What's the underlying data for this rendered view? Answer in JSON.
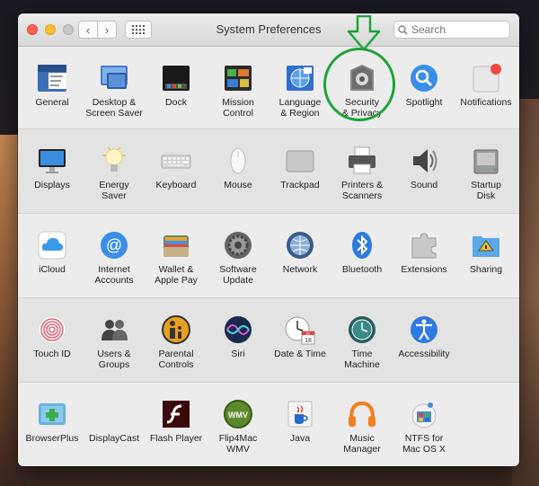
{
  "window": {
    "title": "System Preferences",
    "search_placeholder": "Search"
  },
  "nav": {
    "back": "‹",
    "forward": "›"
  },
  "annotation": {
    "color": "#1fa33a"
  },
  "rows": [
    [
      {
        "id": "general",
        "label": "General",
        "icon": "general-icon"
      },
      {
        "id": "desktop",
        "label": "Desktop &\nScreen Saver",
        "icon": "desktop-screensaver-icon"
      },
      {
        "id": "dock",
        "label": "Dock",
        "icon": "dock-icon"
      },
      {
        "id": "mission",
        "label": "Mission\nControl",
        "icon": "mission-control-icon"
      },
      {
        "id": "language",
        "label": "Language\n& Region",
        "icon": "language-region-icon"
      },
      {
        "id": "security",
        "label": "Security\n& Privacy",
        "icon": "security-privacy-icon"
      },
      {
        "id": "spotlight",
        "label": "Spotlight",
        "icon": "spotlight-icon"
      },
      {
        "id": "notifications",
        "label": "Notifications",
        "icon": "notifications-icon"
      }
    ],
    [
      {
        "id": "displays",
        "label": "Displays",
        "icon": "displays-icon"
      },
      {
        "id": "energy",
        "label": "Energy\nSaver",
        "icon": "energy-saver-icon"
      },
      {
        "id": "keyboard",
        "label": "Keyboard",
        "icon": "keyboard-icon"
      },
      {
        "id": "mouse",
        "label": "Mouse",
        "icon": "mouse-icon"
      },
      {
        "id": "trackpad",
        "label": "Trackpad",
        "icon": "trackpad-icon"
      },
      {
        "id": "printers",
        "label": "Printers &\nScanners",
        "icon": "printer-icon"
      },
      {
        "id": "sound",
        "label": "Sound",
        "icon": "sound-icon"
      },
      {
        "id": "startup",
        "label": "Startup\nDisk",
        "icon": "startup-disk-icon"
      }
    ],
    [
      {
        "id": "icloud",
        "label": "iCloud",
        "icon": "icloud-icon"
      },
      {
        "id": "internet",
        "label": "Internet\nAccounts",
        "icon": "internet-accounts-icon"
      },
      {
        "id": "wallet",
        "label": "Wallet &\nApple Pay",
        "icon": "wallet-icon"
      },
      {
        "id": "software",
        "label": "Software\nUpdate",
        "icon": "software-update-icon"
      },
      {
        "id": "network",
        "label": "Network",
        "icon": "network-icon"
      },
      {
        "id": "bluetooth",
        "label": "Bluetooth",
        "icon": "bluetooth-icon"
      },
      {
        "id": "extensions",
        "label": "Extensions",
        "icon": "extensions-icon"
      },
      {
        "id": "sharing",
        "label": "Sharing",
        "icon": "sharing-icon"
      }
    ],
    [
      {
        "id": "touchid",
        "label": "Touch ID",
        "icon": "touch-id-icon"
      },
      {
        "id": "users",
        "label": "Users &\nGroups",
        "icon": "users-groups-icon"
      },
      {
        "id": "parental",
        "label": "Parental\nControls",
        "icon": "parental-controls-icon"
      },
      {
        "id": "siri",
        "label": "Siri",
        "icon": "siri-icon"
      },
      {
        "id": "datetime",
        "label": "Date & Time",
        "icon": "date-time-icon"
      },
      {
        "id": "timemachine",
        "label": "Time\nMachine",
        "icon": "time-machine-icon"
      },
      {
        "id": "accessibility",
        "label": "Accessibility",
        "icon": "accessibility-icon"
      }
    ],
    [
      {
        "id": "browserplus",
        "label": "BrowserPlus",
        "icon": "browserplus-icon"
      },
      {
        "id": "displaycast",
        "label": "DisplayCast",
        "icon": "displaycast-icon"
      },
      {
        "id": "flash",
        "label": "Flash Player",
        "icon": "flash-player-icon"
      },
      {
        "id": "flip4mac",
        "label": "Flip4Mac\nWMV",
        "icon": "flip4mac-icon"
      },
      {
        "id": "java",
        "label": "Java",
        "icon": "java-icon"
      },
      {
        "id": "music",
        "label": "Music\nManager",
        "icon": "music-manager-icon"
      },
      {
        "id": "ntfs",
        "label": "NTFS for\nMac OS X",
        "icon": "ntfs-icon"
      }
    ]
  ],
  "calendar_icon": {
    "month": "JUL",
    "day": "18"
  },
  "flip4mac_icon_text": "WMV"
}
